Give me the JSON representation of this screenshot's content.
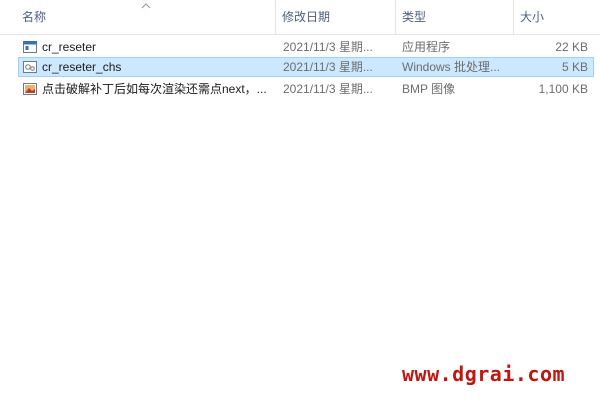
{
  "columns": {
    "name": "名称",
    "date": "修改日期",
    "type": "类型",
    "size": "大小"
  },
  "files": [
    {
      "name": "cr_reseter",
      "date": "2021/11/3 星期...",
      "type": "应用程序",
      "size": "22 KB",
      "icon": "exe-icon"
    },
    {
      "name": "cr_reseter_chs",
      "date": "2021/11/3 星期...",
      "type": "Windows 批处理...",
      "size": "5 KB",
      "icon": "batch-file-icon"
    },
    {
      "name": "点击破解补丁后如每次渲染还需点next，...",
      "date": "2021/11/3 星期...",
      "type": "BMP 图像",
      "size": "1,100 KB",
      "icon": "bmp-image-icon"
    }
  ],
  "selected_index": 1,
  "watermark": "www.dgrai.com"
}
